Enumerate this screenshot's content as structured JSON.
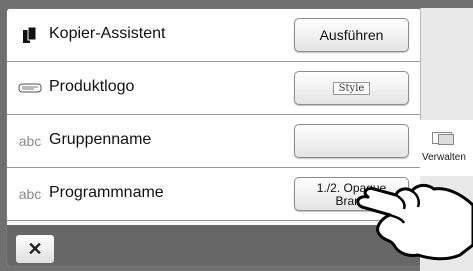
{
  "rows": [
    {
      "icon": "copy-assistant-icon",
      "label": "Kopier-Assistent",
      "action": "Ausführen"
    },
    {
      "icon": "product-logo-icon",
      "label": "Produktlogo",
      "action": "Style"
    },
    {
      "icon": "abc-text-icon",
      "label": "Gruppenname",
      "action": ""
    },
    {
      "icon": "abc-text-icon",
      "label": "Programmname",
      "action_line1": "1./2. Opaque",
      "action_line2": "Brand"
    }
  ],
  "abc_text": "abc",
  "side": {
    "manage_label": "Verwalten"
  },
  "footer": {
    "close_symbol": "✕"
  }
}
